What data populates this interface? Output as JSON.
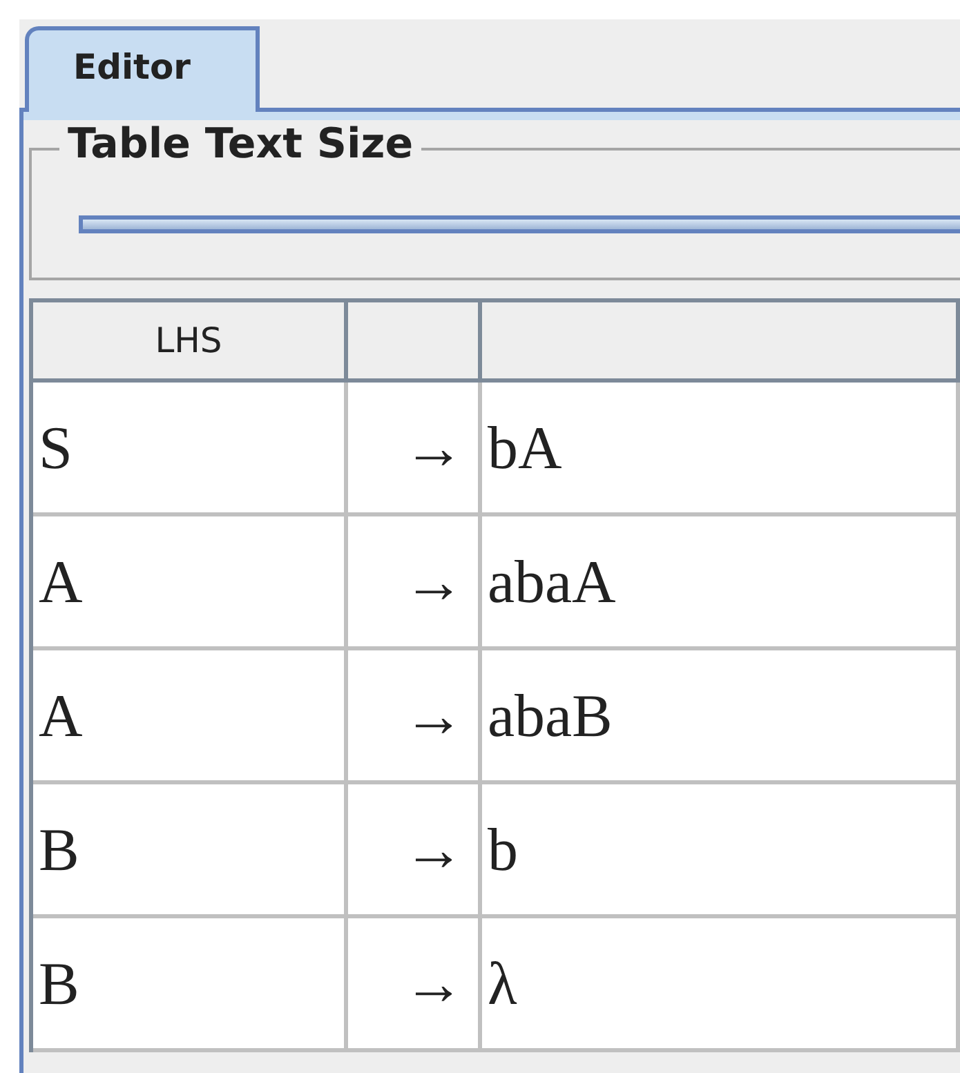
{
  "tabs": [
    {
      "label": "Editor",
      "selected": true
    }
  ],
  "text_size_group": {
    "title": "Table Text Size"
  },
  "table": {
    "columns": [
      "LHS",
      "",
      ""
    ],
    "rows": [
      {
        "lhs": "S",
        "arrow": "→",
        "rhs": "bA"
      },
      {
        "lhs": "A",
        "arrow": "→",
        "rhs": "abaA"
      },
      {
        "lhs": "A",
        "arrow": "→",
        "rhs": "abaB"
      },
      {
        "lhs": "B",
        "arrow": "→",
        "rhs": "b"
      },
      {
        "lhs": "B",
        "arrow": "→",
        "rhs": "λ"
      }
    ]
  }
}
